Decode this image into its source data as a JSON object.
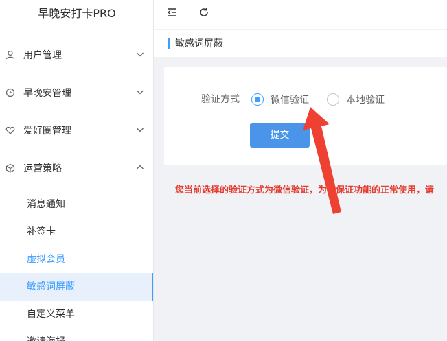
{
  "app": {
    "title": "早晚安打卡PRO"
  },
  "sidebar": {
    "menus": [
      {
        "label": "用户管理",
        "icon": "user-icon",
        "expanded": false
      },
      {
        "label": "早晚安管理",
        "icon": "clock-icon",
        "expanded": false
      },
      {
        "label": "爱好圈管理",
        "icon": "heart-icon",
        "expanded": false
      },
      {
        "label": "运营策略",
        "icon": "cube-icon",
        "expanded": true
      }
    ],
    "subitems": [
      {
        "label": "消息通知"
      },
      {
        "label": "补签卡"
      },
      {
        "label": "虚拟会员"
      },
      {
        "label": "敏感词屏蔽"
      },
      {
        "label": "自定义菜单"
      },
      {
        "label": "邀请海报"
      }
    ]
  },
  "navbar": {
    "icons": [
      "collapse-menu-icon",
      "refresh-icon"
    ]
  },
  "tag": {
    "label": "敏感词屏蔽"
  },
  "form": {
    "label": "验证方式",
    "options": [
      {
        "label": "微信验证",
        "checked": true
      },
      {
        "label": "本地验证",
        "checked": false
      }
    ],
    "submit_label": "提交"
  },
  "warning": "您当前选择的验证方式为微信验证，为了保证功能的正常使用，请",
  "colors": {
    "accent": "#409eff",
    "button": "#4a94ea",
    "warning": "#e33b2f",
    "arrow": "#ef4132"
  }
}
